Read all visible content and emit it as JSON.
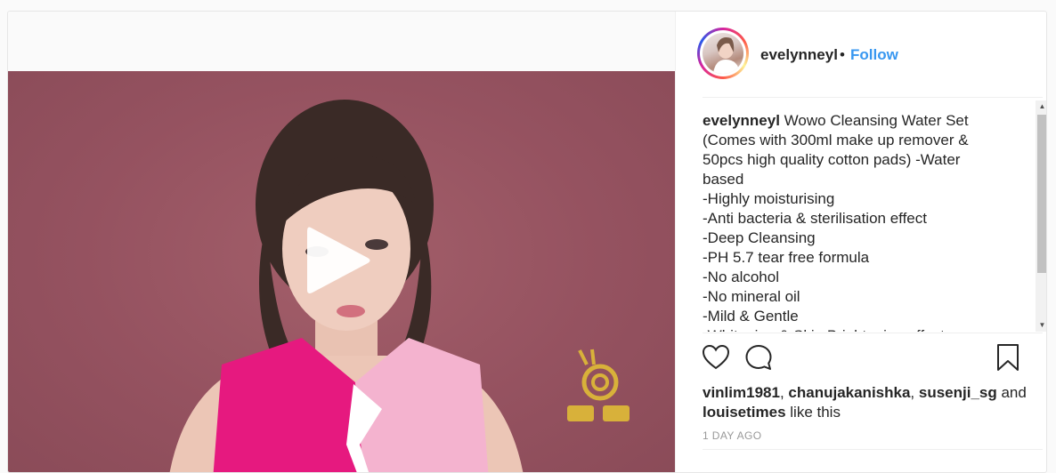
{
  "post": {
    "author": "evelynneyl",
    "separator": "•",
    "follow_label": "Follow",
    "caption_user": "evelynneyl",
    "caption_text": " Wowo Cleansing Water Set (Comes with 300ml make up remover & 50pcs high quality cotton pads) -Water based\n-Highly moisturising\n-Anti bacteria & sterilisation effect\n-Deep Cleansing\n-PH 5.7 tear free formula\n-No alcohol\n-No mineral oil\n-Mild & Gentle\n-Whitening & Skin Brightening effect",
    "likes": {
      "user1": "vinlim1981",
      "sep1": ", ",
      "user2": "chanujakanishka",
      "sep2": ", ",
      "user3": "susenji_sg",
      "and": " and",
      "user4": "louisetimes",
      "suffix": " like this"
    },
    "timestamp": "1 DAY AGO"
  },
  "icons": {
    "play": "play-icon",
    "like": "heart-icon",
    "comment": "comment-icon",
    "save": "bookmark-icon",
    "brand": "snail-logo-icon"
  },
  "colors": {
    "accent": "#3897f0",
    "video_bg": "#955260",
    "text": "#262626",
    "muted": "#999999"
  }
}
